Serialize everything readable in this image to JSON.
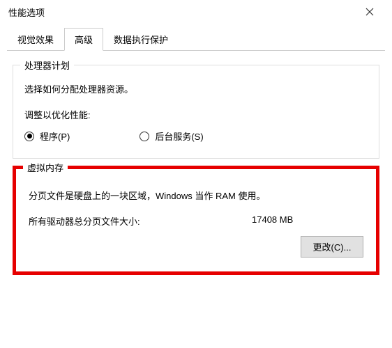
{
  "window": {
    "title": "性能选项"
  },
  "tabs": {
    "visual": "视觉效果",
    "advanced": "高级",
    "dep": "数据执行保护"
  },
  "processor": {
    "group_title": "处理器计划",
    "description": "选择如何分配处理器资源。",
    "adjust_label": "调整以优化性能:",
    "radio_programs": "程序(P)",
    "radio_background": "后台服务(S)"
  },
  "virtual_memory": {
    "group_title": "虚拟内存",
    "description": "分页文件是硬盘上的一块区域，Windows 当作 RAM 使用。",
    "total_label": "所有驱动器总分页文件大小:",
    "total_value": "17408 MB",
    "change_button": "更改(C)..."
  }
}
